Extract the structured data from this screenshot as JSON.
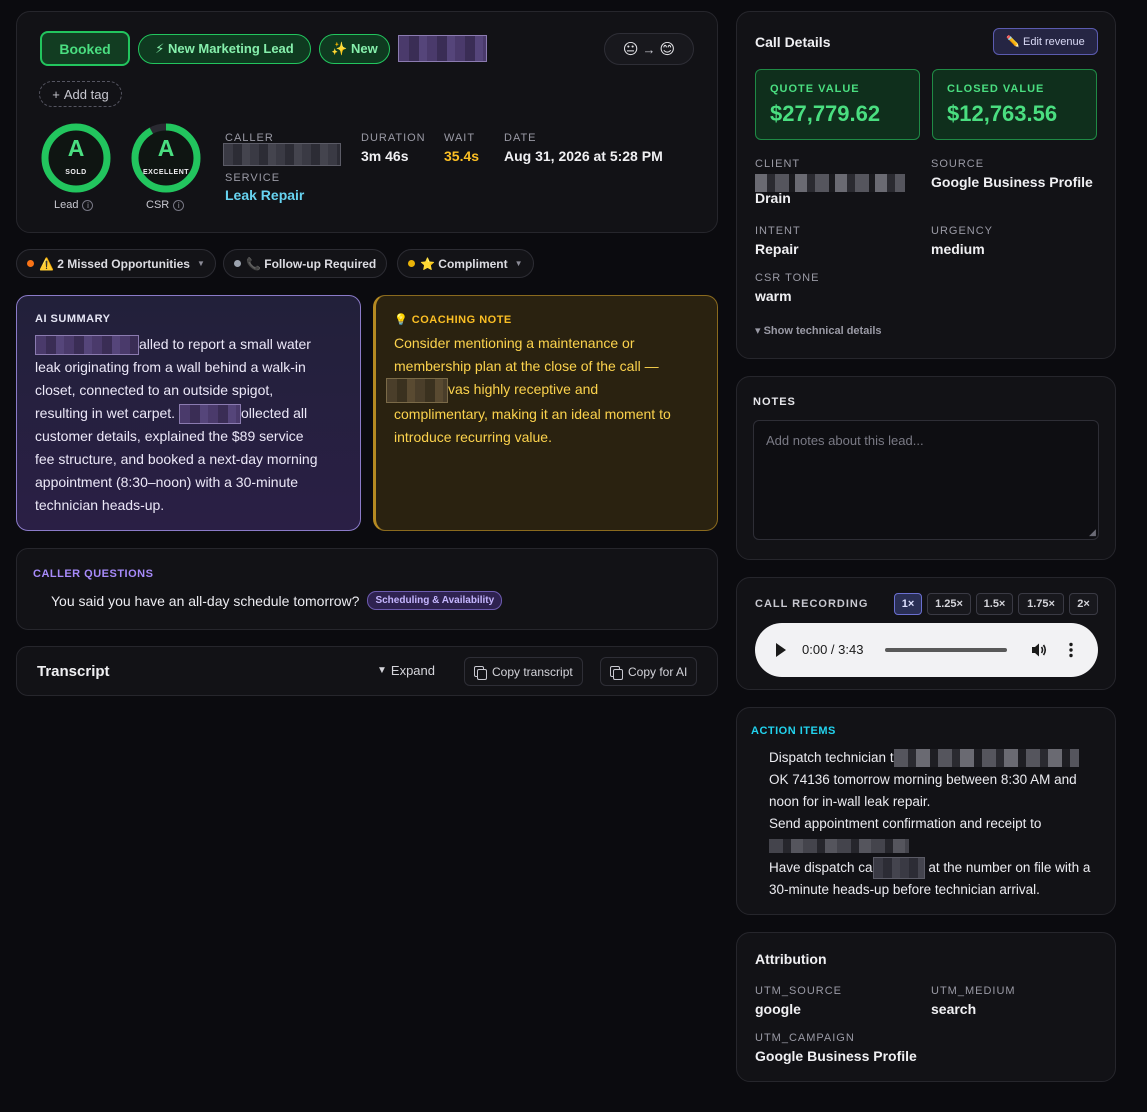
{
  "header": {
    "status_badge": "Booked",
    "tags": [
      "⚡ New Marketing Lead",
      "✨ New"
    ],
    "sentiment_from": "😐",
    "sentiment_arrow": "→",
    "sentiment_to": "😊",
    "add_tag_label": "Add tag",
    "gauges": [
      {
        "grade": "A",
        "sub": "SOLD",
        "caption": "Lead",
        "fill": 1.0
      },
      {
        "grade": "A",
        "sub": "EXCELLENT",
        "caption": "CSR",
        "fill": 0.92
      }
    ],
    "caller_label": "CALLER",
    "service_label": "SERVICE",
    "service_value": "Leak Repair",
    "duration_label": "DURATION",
    "duration_value": "3m 46s",
    "wait_label": "WAIT",
    "wait_value": "35.4s",
    "date_label": "DATE",
    "date_value": "Aug 31, 2026 at 5:28 PM"
  },
  "chips": [
    {
      "label": "⚠️ 2 Missed Opportunities",
      "dot_color": "#f97316",
      "has_caret": true
    },
    {
      "label": "📞 Follow-up Required",
      "dot_color": "#9ca3af",
      "has_caret": false
    },
    {
      "label": "⭐ Compliment",
      "dot_color": "#eab308",
      "has_caret": true
    }
  ],
  "ai_summary": {
    "heading": "AI SUMMARY",
    "lines": [
      "alled to report a small water",
      "leak originating from a wall behind a walk-in",
      "closet, connected to an outside spigot,",
      "resulting in wet carpet.",
      "ollected all",
      "customer details, explained the $89 service",
      "fee structure, and booked a next-day morning",
      "appointment (8:30–noon) with a 30-minute",
      "technician heads-up."
    ]
  },
  "coaching": {
    "heading": "COACHING NOTE",
    "icon": "💡",
    "lines": [
      "Consider mentioning a maintenance or",
      "membership plan at the close of the call —",
      "vas highly receptive and",
      "complimentary, making it an ideal moment to",
      "introduce recurring value."
    ]
  },
  "questions": {
    "heading": "CALLER QUESTIONS",
    "text": "You said you have an all-day schedule tomorrow?",
    "tag": "Scheduling & Availability"
  },
  "transcript": {
    "title": "Transcript",
    "expand": "Expand",
    "copy_transcript": "Copy transcript",
    "copy_ai": "Copy for AI"
  },
  "details": {
    "title": "Call Details",
    "edit_revenue": "✏️ Edit revenue",
    "quote_label": "QUOTE VALUE",
    "quote_value": "$27,779.62",
    "closed_label": "CLOSED VALUE",
    "closed_value": "$12,763.56",
    "client_label": "CLIENT",
    "client_value_tail": "Drain",
    "source_label": "SOURCE",
    "source_value": "Google Business Profile",
    "intent_label": "INTENT",
    "intent_value": "Repair",
    "urgency_label": "URGENCY",
    "urgency_value": "medium",
    "tone_label": "CSR TONE",
    "tone_value": "warm",
    "tech_toggle": "▾ Show technical details"
  },
  "notes": {
    "heading": "NOTES",
    "placeholder": "Add notes about this lead..."
  },
  "recording": {
    "heading": "CALL RECORDING",
    "speeds": [
      "1×",
      "1.25×",
      "1.5×",
      "1.75×",
      "2×"
    ],
    "active_speed": "1×",
    "time": "0:00 / 3:43",
    "progress": 0
  },
  "actions": {
    "heading": "ACTION ITEMS",
    "items": [
      {
        "lines": [
          "Dispatch technician t",
          "OK 74136 tomorrow morning between 8:30 AM and",
          "noon for in-wall leak repair."
        ]
      },
      {
        "lines": [
          "Send appointment confirmation and receipt to",
          ""
        ]
      },
      {
        "lines": [
          "Have dispatch ca",
          "at the number on file with a",
          "30-minute heads-up before technician arrival."
        ]
      }
    ]
  },
  "attribution": {
    "title": "Attribution",
    "utm_source_label": "UTM_SOURCE",
    "utm_source": "google",
    "utm_medium_label": "UTM_MEDIUM",
    "utm_medium": "search",
    "utm_campaign_label": "UTM_CAMPAIGN",
    "utm_campaign": "Google Business Profile"
  },
  "colors": {
    "accent_green": "#4ade80",
    "accent_purple": "#a78bfa",
    "accent_amber": "#fbbf24",
    "accent_cyan": "#22d3ee"
  }
}
